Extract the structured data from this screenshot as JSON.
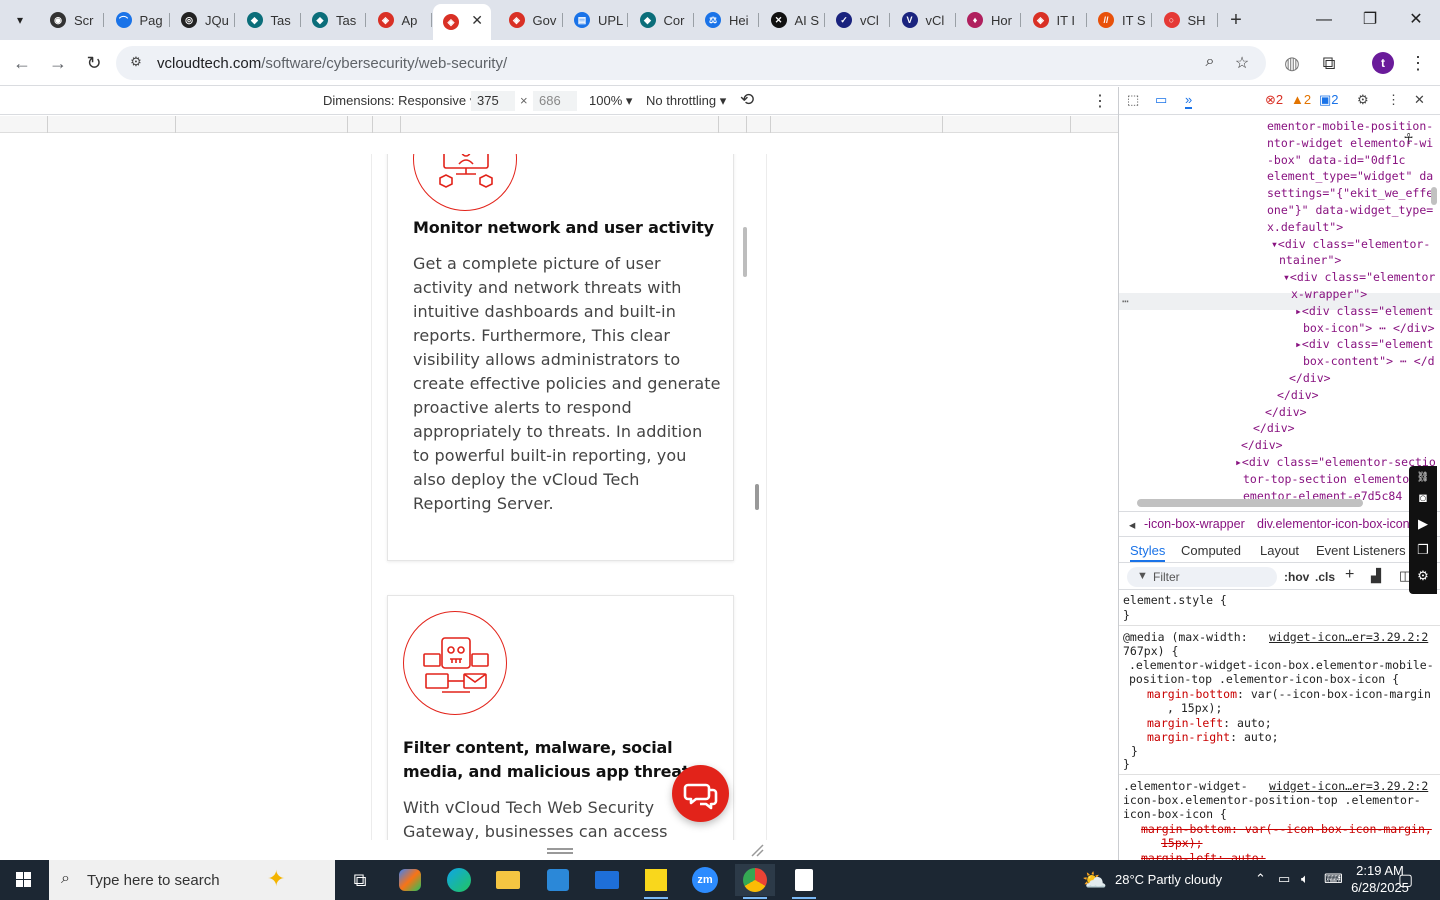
{
  "browser": {
    "tabs": [
      {
        "label": "Scr",
        "fav_color": "#333333",
        "fav_glyph": "◉"
      },
      {
        "label": "Pag",
        "fav_color": "#1a73e8",
        "fav_glyph": "⌒"
      },
      {
        "label": "JQu",
        "fav_color": "#222222",
        "fav_glyph": "◎"
      },
      {
        "label": "Tas",
        "fav_color": "#0b6e7a",
        "fav_glyph": "◆"
      },
      {
        "label": "Tas",
        "fav_color": "#0b6e7a",
        "fav_glyph": "◆"
      },
      {
        "label": "Ap",
        "fav_color": "#d93025",
        "fav_glyph": "◈"
      },
      {
        "label": "",
        "fav_color": "#d93025",
        "fav_glyph": "◈",
        "active": true
      },
      {
        "label": "Gov",
        "fav_color": "#d93025",
        "fav_glyph": "◈"
      },
      {
        "label": "UPL",
        "fav_color": "#1a73e8",
        "fav_glyph": "▤"
      },
      {
        "label": "Cor",
        "fav_color": "#0b6e7a",
        "fav_glyph": "◆"
      },
      {
        "label": "Hei",
        "fav_color": "#1a73e8",
        "fav_glyph": "⚖"
      },
      {
        "label": "AI S",
        "fav_color": "#111111",
        "fav_glyph": "✕"
      },
      {
        "label": "vCl",
        "fav_color": "#1a237e",
        "fav_glyph": "✓"
      },
      {
        "label": "vCl",
        "fav_color": "#1a237e",
        "fav_glyph": "V"
      },
      {
        "label": "Hor",
        "fav_color": "#b0205e",
        "fav_glyph": "♦"
      },
      {
        "label": "IT I",
        "fav_color": "#d93025",
        "fav_glyph": "◈"
      },
      {
        "label": "IT S",
        "fav_color": "#e8510a",
        "fav_glyph": "//"
      },
      {
        "label": "SH",
        "fav_color": "#e53935",
        "fav_glyph": "○"
      }
    ],
    "close_glyph": "✕",
    "new_tab_glyph": "+",
    "window_controls": {
      "minimize": "—",
      "maximize": "❐",
      "close": "✕"
    },
    "url_domain": "vcloudtech.com",
    "url_path": "/software/cybersecurity/web-security/",
    "profile_initial": "t"
  },
  "device_toolbar": {
    "dimensions_label": "Dimensions: Responsive",
    "width": "375",
    "height": "686",
    "times": "×",
    "zoom": "100%",
    "throttling": "No throttling",
    "more": "⋮"
  },
  "page": {
    "card1": {
      "title": "Monitor network and user activity",
      "lines": [
        "Get a complete picture of user",
        "activity and network threats with",
        "intuitive dashboards and built-in",
        "reports. Furthermore, This clear",
        "visibility allows administrators to",
        "create effective policies and generate",
        "proactive alerts to respond",
        "appropriately to threats. In addition",
        "to powerful built-in reporting, you",
        "also deploy the vCloud Tech",
        "Reporting Server."
      ]
    },
    "card2": {
      "title_lines": [
        "Filter content, malware, social",
        "media, and malicious app threats"
      ],
      "lines": [
        "With vCloud Tech Web Security",
        "Gateway, businesses can access"
      ]
    },
    "accent_color": "#e2231a"
  },
  "devtools": {
    "errors": "2",
    "warnings": "2",
    "messages": "2",
    "dom_lines": [
      {
        "indent": 148,
        "text": "ementor-mobile-position-"
      },
      {
        "indent": 148,
        "text": "ntor-widget elementor-wi"
      },
      {
        "indent": 148,
        "text": "-box\" data-id=\"0df1c"
      },
      {
        "indent": 148,
        "text": "element_type=\"widget\" da"
      },
      {
        "indent": 148,
        "text": "settings=\"{\"ekit_we_effe"
      },
      {
        "indent": 148,
        "text": "one\"}\" data-widget_type="
      },
      {
        "indent": 148,
        "text": "x.default\">"
      },
      {
        "indent": 152,
        "text": "▾<div class=\"elementor-"
      },
      {
        "indent": 160,
        "text": "ntainer\">"
      },
      {
        "indent": 164,
        "text": "▾<div class=\"elementor"
      },
      {
        "indent": 172,
        "text": "x-wrapper\">"
      },
      {
        "indent": 176,
        "text": "▸<div class=\"element"
      },
      {
        "indent": 184,
        "text": "box-icon\"> ⋯ </div>"
      },
      {
        "indent": 176,
        "text": "▸<div class=\"element"
      },
      {
        "indent": 184,
        "text": "box-content\"> ⋯ </d"
      },
      {
        "indent": 170,
        "text": "</div>"
      },
      {
        "indent": 158,
        "text": "</div>"
      },
      {
        "indent": 146,
        "text": "</div>"
      },
      {
        "indent": 134,
        "text": "</div>"
      },
      {
        "indent": 122,
        "text": "</div>"
      },
      {
        "indent": 116,
        "text": "▸<div class=\"elementor-sectio"
      },
      {
        "indent": 124,
        "text": "tor-top-section elementor"
      },
      {
        "indent": 124,
        "text": "ementor-element-e7d5c84 e"
      }
    ],
    "breadcrumbs": [
      "-icon-box-wrapper",
      "div.elementor-icon-box-icon"
    ],
    "style_tabs": [
      "Styles",
      "Computed",
      "Layout",
      "Event Listeners"
    ],
    "filter_placeholder": "Filter",
    "hov": ":hov",
    "cls": ".cls",
    "styles": {
      "element_style": "element.style {",
      "close_brace": "}",
      "media": "@media (max-width:",
      "media2": "767px) {",
      "source1": "widget-icon…er=3.29.2:2",
      "rule1_sel1": ".elementor-widget-icon-box.elementor-mobile-",
      "rule1_sel2": "position-top .elementor-icon-box-icon {",
      "rule1_p1": "margin-bottom",
      "rule1_v1": "var(--icon-box-icon-margin",
      "rule1_v1b": ", 15px);",
      "rule1_p2": "margin-left",
      "rule1_v2": "auto;",
      "rule1_p3": "margin-right",
      "rule1_v3": "auto;",
      "rule2_sel1": ".elementor-widget-",
      "source2": "widget-icon…er=3.29.2:2",
      "rule2_sel2": "icon-box.elementor-position-top .elementor-",
      "rule2_sel3": "icon-box-icon {",
      "rule2_strike1": "margin-bottom: var(--icon-box-icon-margin,",
      "rule2_strike1b": "15px);",
      "rule2_strike2": "margin-left: auto;"
    }
  },
  "taskbar": {
    "search_placeholder": "Type here to search",
    "weather": "28°C  Partly cloudy",
    "time": "2:19 AM",
    "date": "6/28/2025"
  }
}
